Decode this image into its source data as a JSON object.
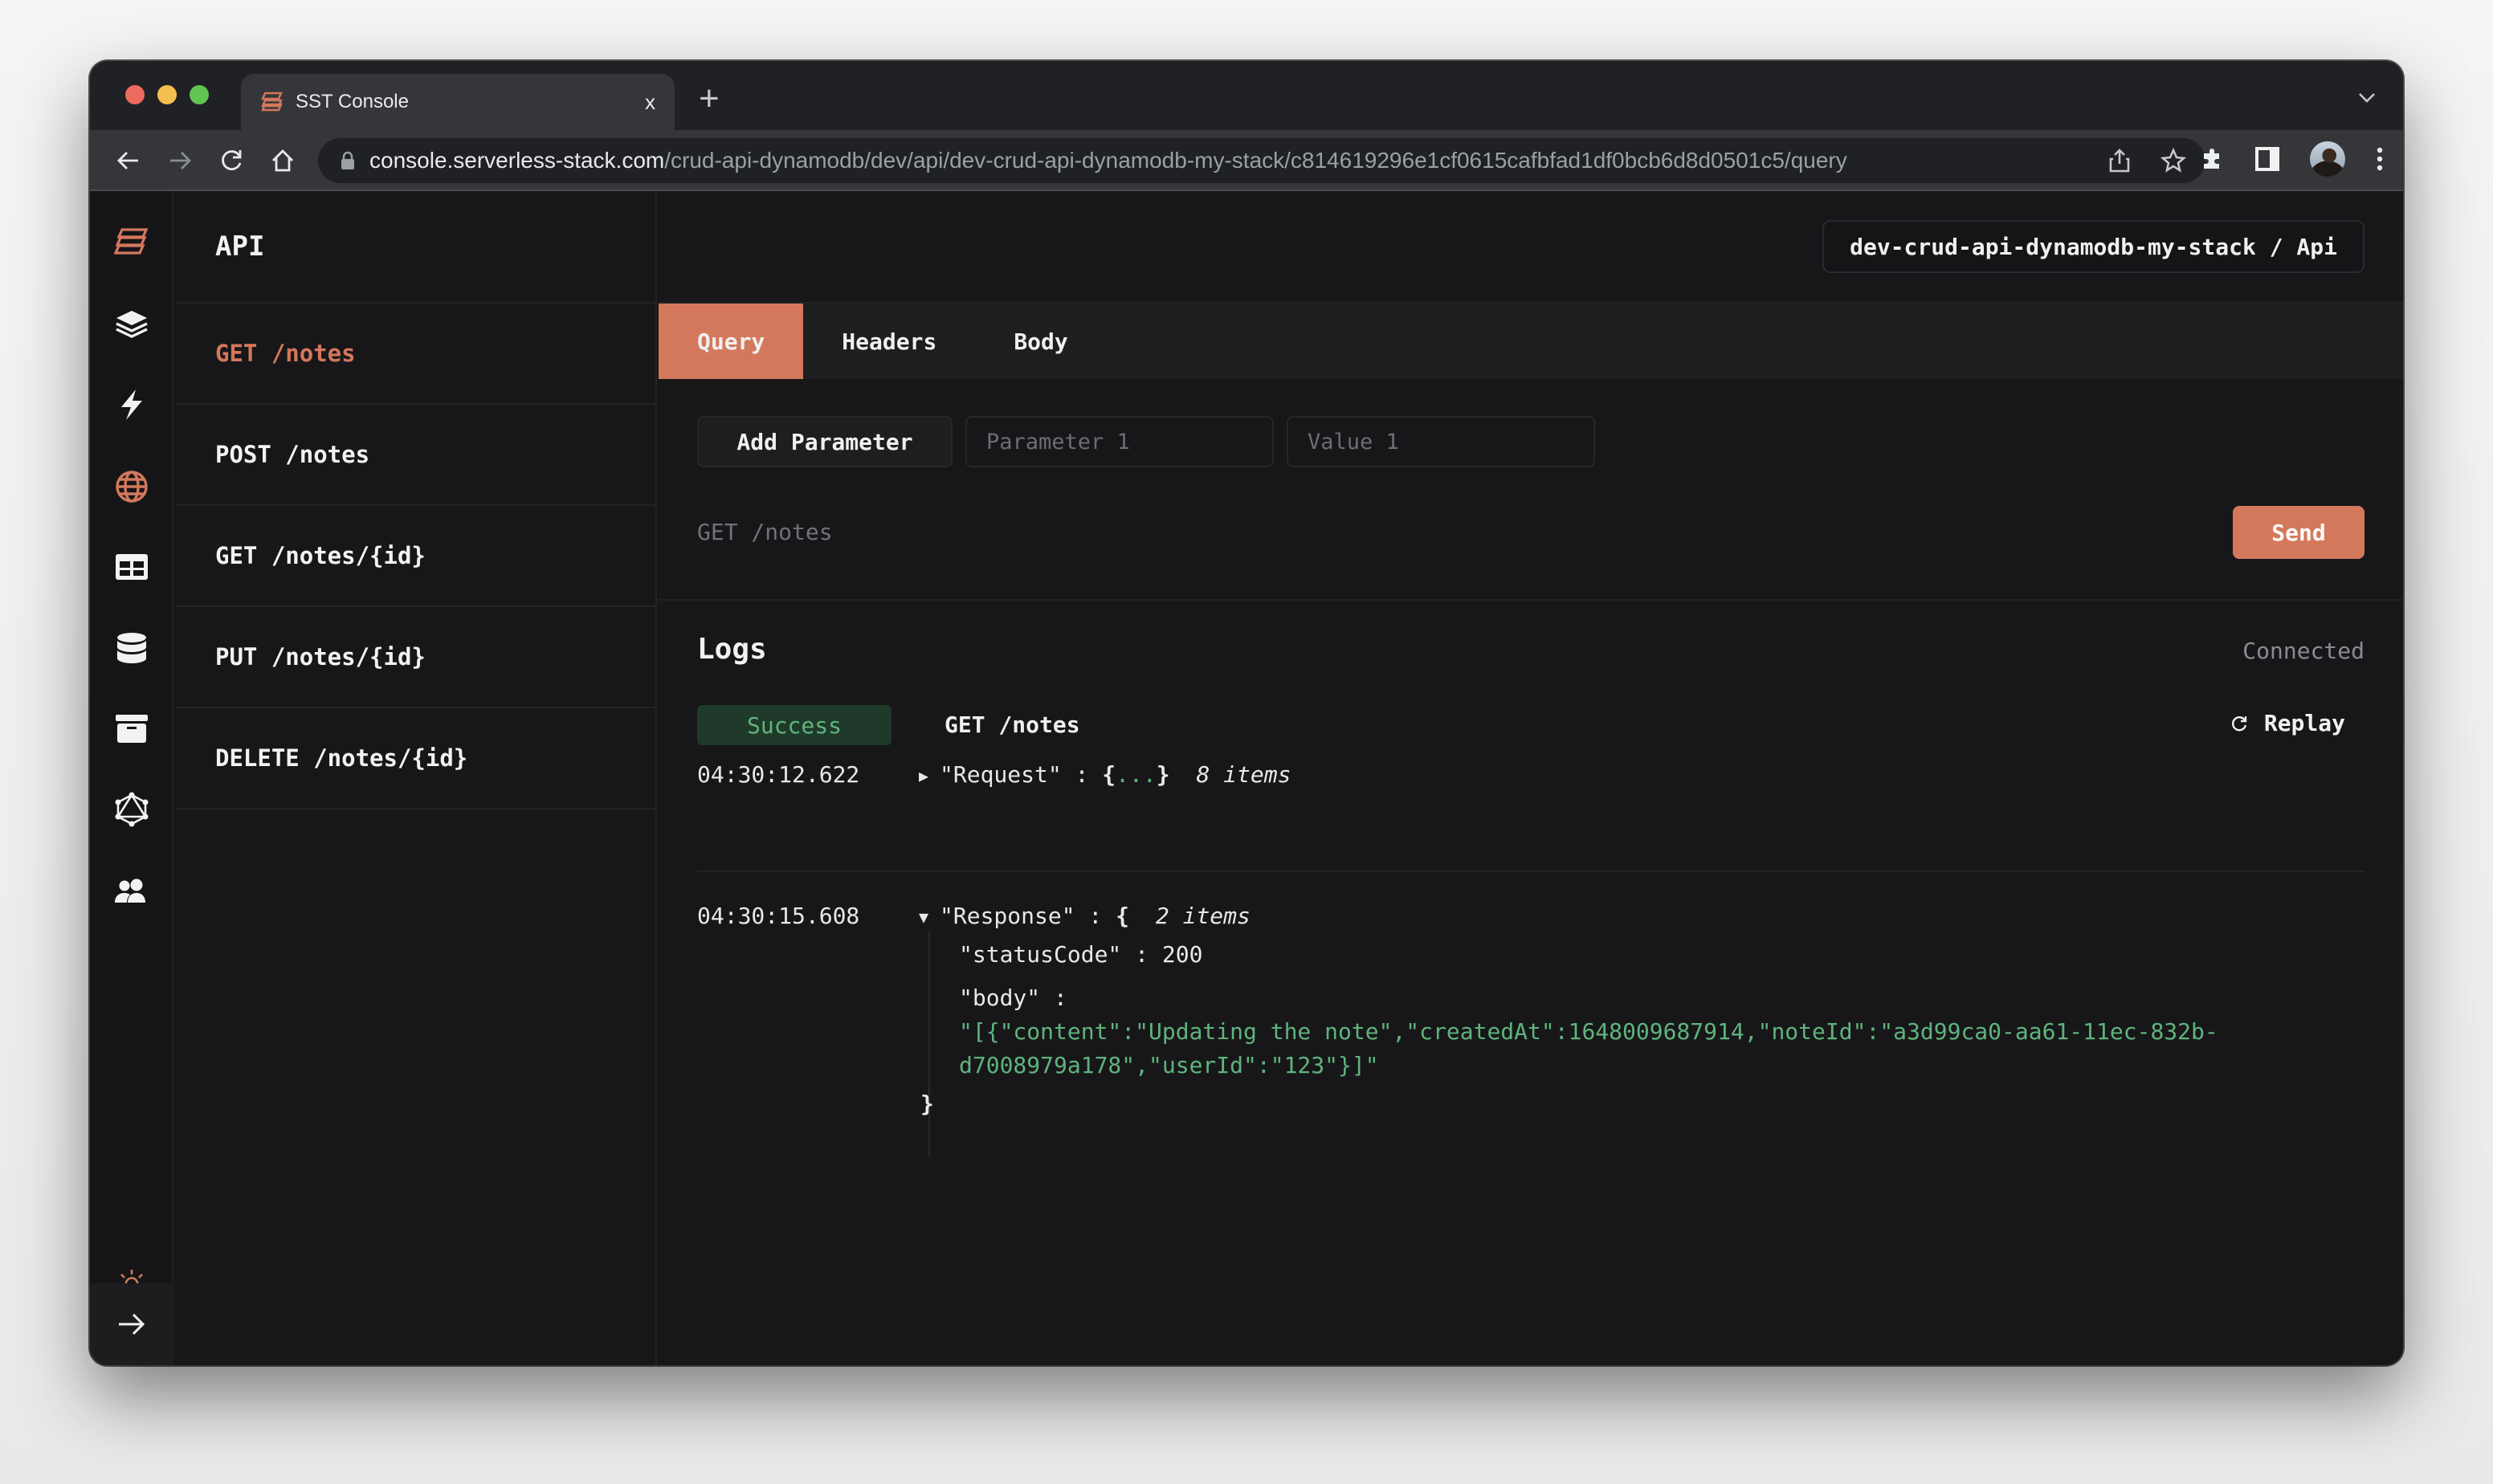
{
  "browser": {
    "tab_title": "SST Console",
    "tab_close": "x",
    "new_tab": "+",
    "url_host": "console.serverless-stack.com",
    "url_path": "/crud-api-dynamodb/dev/api/dev-crud-api-dynamodb-my-stack/c814619296e1cf0615cafbfad1df0bcb6d8d0501c5/query"
  },
  "theme": {
    "accent": "#d4785c",
    "success": "#5fb47c",
    "background": "#17171a"
  },
  "iconbar": {
    "items": [
      {
        "icon": "sst-logo-icon",
        "active": true
      },
      {
        "icon": "stacks-icon"
      },
      {
        "icon": "functions-icon"
      },
      {
        "icon": "api-globe-icon",
        "active": true
      },
      {
        "icon": "dynamodb-table-icon"
      },
      {
        "icon": "rds-database-icon"
      },
      {
        "icon": "buckets-icon"
      },
      {
        "icon": "graphql-icon"
      },
      {
        "icon": "cognito-users-icon"
      }
    ],
    "bottom": [
      {
        "icon": "theme-sun-icon"
      },
      {
        "icon": "expand-arrow-icon"
      }
    ]
  },
  "routes": {
    "title": "API",
    "items": [
      {
        "label": "GET /notes",
        "active": true
      },
      {
        "label": "POST /notes"
      },
      {
        "label": "GET /notes/{id}"
      },
      {
        "label": "PUT /notes/{id}"
      },
      {
        "label": "DELETE /notes/{id}"
      }
    ]
  },
  "main": {
    "breadcrumb": "dev-crud-api-dynamodb-my-stack / Api",
    "tabs": [
      {
        "label": "Query",
        "active": true
      },
      {
        "label": "Headers"
      },
      {
        "label": "Body"
      }
    ],
    "add_parameter": "Add Parameter",
    "param_placeholder": "Parameter 1",
    "value_placeholder": "Value 1",
    "request_line": "GET /notes",
    "send": "Send"
  },
  "logs": {
    "title": "Logs",
    "status": "Connected",
    "badge": "Success",
    "route": "GET /notes",
    "replay": "Replay",
    "request": {
      "time": "04:30:12.622",
      "key": "\"Request\"",
      "colon": " : ",
      "open": "{",
      "ellipsis": "...",
      "close": "}",
      "count": "8 items"
    },
    "response": {
      "time": "04:30:15.608",
      "key": "\"Response\"",
      "colon": " : ",
      "open": "{",
      "count": "2 items",
      "status_key": "\"statusCode\"",
      "status_value": "200",
      "body_key": "\"body\"",
      "body_line1": "\"[{\"content\":\"Updating the note\",\"createdAt\":1648009687914,\"noteId\":\"a3d99ca0-aa61-11ec-832b-",
      "body_line2": "d7008979a178\",\"userId\":\"123\"}]\"",
      "close": "}"
    }
  }
}
